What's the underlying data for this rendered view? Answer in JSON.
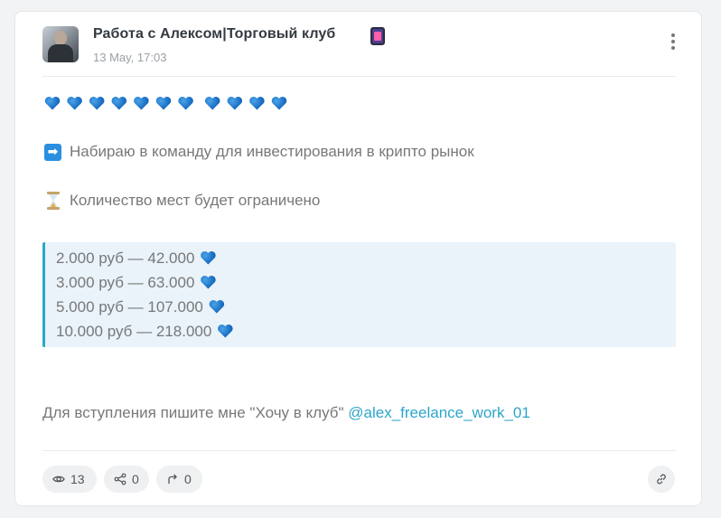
{
  "post": {
    "channel_name": "Работа с Алексом|Торговый клуб",
    "date": "13 May, 17:03",
    "hearts_count": 11,
    "line1": "Набираю в команду для инвестирования в крипто рынок",
    "line2": "Количество мест будет ограничено",
    "prices": [
      "2.000 руб — 42.000",
      "3.000 руб — 63.000",
      "5.000 руб — 107.000",
      "10.000 руб — 218.000"
    ],
    "cta_text": "Для вступления пишите мне \"Хочу в клуб\" ",
    "mention": "@alex_freelance_work_01"
  },
  "footer": {
    "views": "13",
    "shares": "0",
    "forwards": "0"
  },
  "icons": {
    "avatar": "avatar-photo",
    "title_emoji": "mobile-phone-arrow-icon",
    "menu": "kebab-menu-icon",
    "heart": "blue-heart-icon",
    "arrow": "right-arrow-icon",
    "hourglass": "hourglass-icon",
    "views": "eye-icon",
    "shares": "share-icon",
    "forwards": "forward-icon",
    "link": "link-icon"
  },
  "colors": {
    "accent": "#2ba6c9",
    "quote_bg": "#eaf3f9",
    "heart": "#1a6fc4"
  }
}
